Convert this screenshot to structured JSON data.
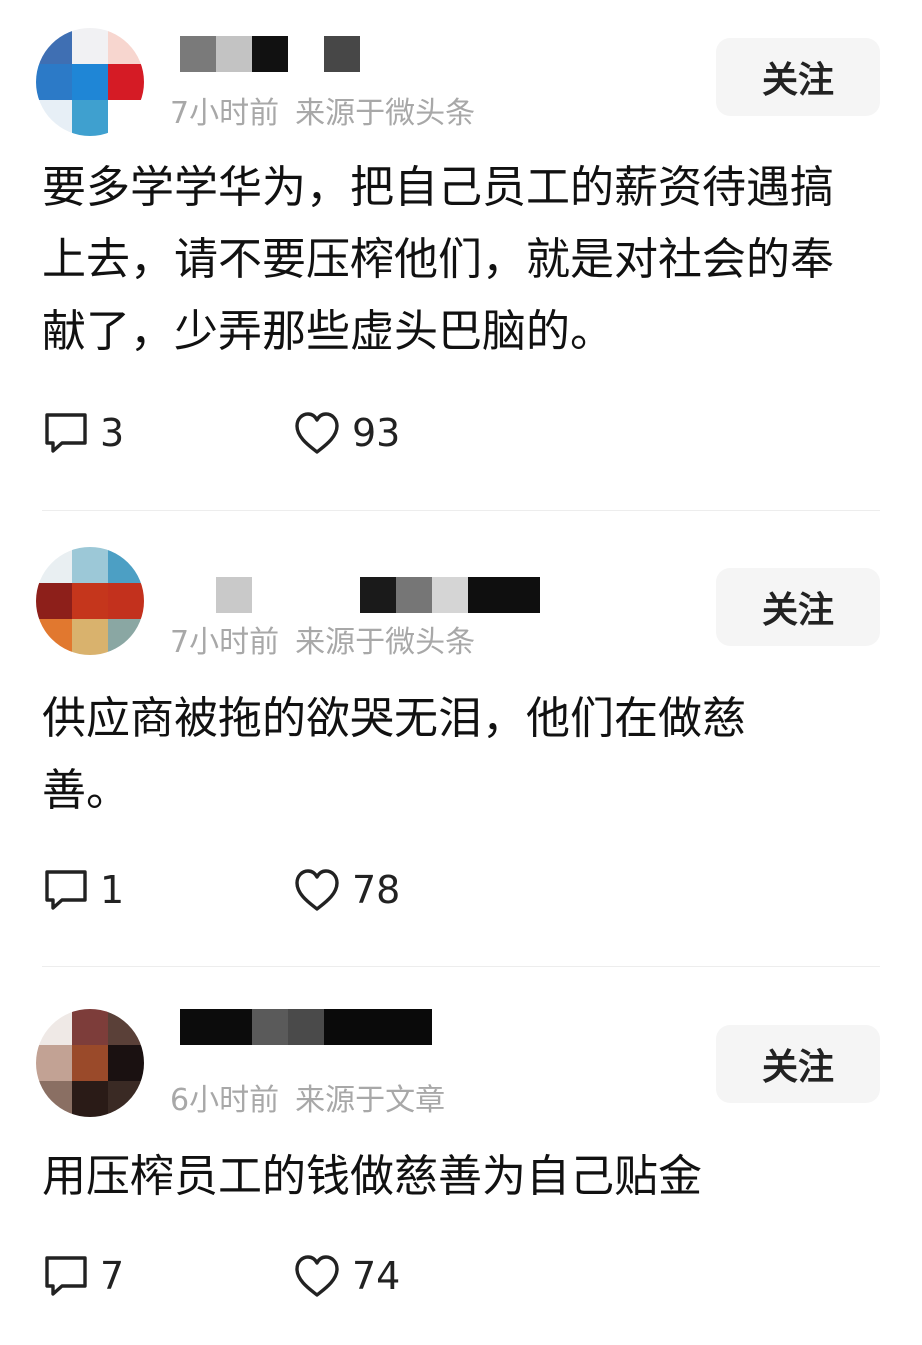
{
  "posts": [
    {
      "time": "7小时前",
      "source": "来源于微头条",
      "follow_label": "关注",
      "text": "要多学学华为，把自己员工的薪资待遇搞上去，请不要压榨他们，就是对社会的奉献了，少弄那些虚头巴脑的。",
      "comments": "3",
      "likes": "93"
    },
    {
      "time": "7小时前",
      "source": "来源于微头条",
      "follow_label": "关注",
      "text": "供应商被拖的欲哭无泪，他们在做慈善。",
      "comments": "1",
      "likes": "78"
    },
    {
      "time": "6小时前",
      "source": "来源于文章",
      "follow_label": "关注",
      "text": "用压榨员工的钱做慈善为自己贴金",
      "comments": "7",
      "likes": "74"
    }
  ],
  "icons": {
    "comment": "comment-icon",
    "like": "heart-icon"
  }
}
